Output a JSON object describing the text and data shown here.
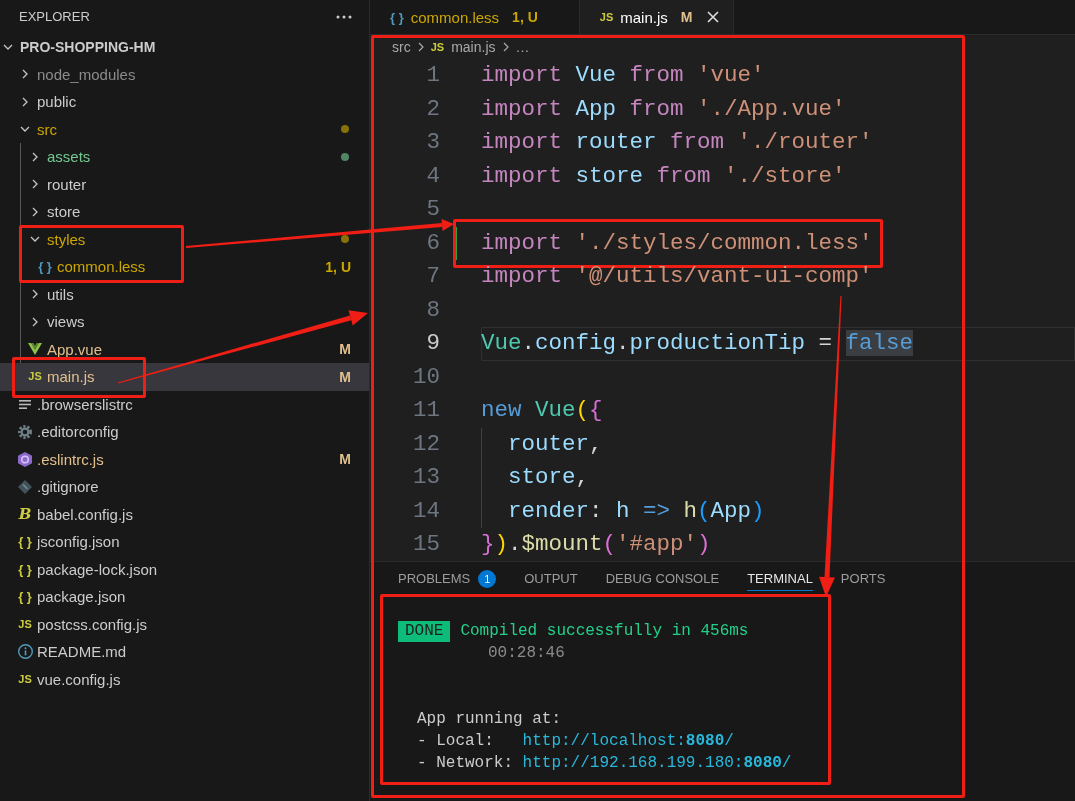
{
  "tabs": [
    {
      "label": "common.less",
      "kind": "less",
      "icon_label": "{ }",
      "color": "#cca700",
      "badge": "1, U",
      "selected": false
    },
    {
      "label": "main.js",
      "kind": "js",
      "icon_label": "JS",
      "color": "#e2c08d",
      "badge": "M",
      "selected": true
    }
  ],
  "explorer": {
    "title": "EXPLORER",
    "project": {
      "name": "PRO-SHOPPING-HM",
      "expanded": true,
      "children": [
        {
          "name": "node_modules",
          "kind": "folder",
          "expanded": false,
          "selected": false,
          "annotated": false,
          "color": "#8c8c8c",
          "dot": false
        },
        {
          "name": "public",
          "kind": "folder",
          "expanded": false,
          "selected": false,
          "annotated": false,
          "dot": false
        },
        {
          "name": "src",
          "kind": "folder",
          "expanded": true,
          "selected": false,
          "annotated": false,
          "color": "#cca700",
          "dot": true,
          "children": [
            {
              "name": "assets",
              "kind": "folder",
              "expanded": false,
              "selected": false,
              "annotated": false,
              "color": "#73c991",
              "dot": true
            },
            {
              "name": "router",
              "kind": "folder",
              "expanded": false,
              "selected": false,
              "annotated": false,
              "dot": false
            },
            {
              "name": "store",
              "kind": "folder",
              "expanded": false,
              "selected": false,
              "annotated": false,
              "dot": false
            },
            {
              "name": "styles",
              "kind": "folder",
              "expanded": true,
              "selected": false,
              "annotated": true,
              "color": "#cca700",
              "dot": true,
              "children": [
                {
                  "name": "common.less",
                  "kind": "less",
                  "icon_label": "{ }",
                  "selected": false,
                  "annotated": false,
                  "color": "#cca700",
                  "badge": "1, U"
                }
              ]
            },
            {
              "name": "utils",
              "kind": "folder",
              "expanded": false,
              "selected": false,
              "annotated": false,
              "dot": false
            },
            {
              "name": "views",
              "kind": "folder",
              "expanded": false,
              "selected": false,
              "annotated": false,
              "dot": false
            },
            {
              "name": "App.vue",
              "kind": "vue",
              "selected": false,
              "annotated": false,
              "color": "#e2c08d",
              "badge": "M"
            },
            {
              "name": "main.js",
              "kind": "js",
              "icon_label": "JS",
              "selected": true,
              "annotated": true,
              "color": "#e2c08d",
              "badge": "M"
            }
          ]
        },
        {
          "name": ".browserslistrc",
          "kind": "text",
          "selected": false,
          "annotated": false
        },
        {
          "name": ".editorconfig",
          "kind": "config",
          "selected": false,
          "annotated": false
        },
        {
          "name": ".eslintrc.js",
          "kind": "eslint",
          "selected": false,
          "annotated": false,
          "color": "#e2c08d",
          "badge": "M"
        },
        {
          "name": ".gitignore",
          "kind": "git",
          "selected": false,
          "annotated": false
        },
        {
          "name": "babel.config.js",
          "kind": "babel",
          "icon_label": "B",
          "selected": false,
          "annotated": false
        },
        {
          "name": "jsconfig.json",
          "kind": "json",
          "icon_label": "{ }",
          "selected": false,
          "annotated": false
        },
        {
          "name": "package-lock.json",
          "kind": "json",
          "icon_label": "{ }",
          "selected": false,
          "annotated": false
        },
        {
          "name": "package.json",
          "kind": "json",
          "icon_label": "{ }",
          "selected": false,
          "annotated": false
        },
        {
          "name": "postcss.config.js",
          "kind": "js",
          "icon_label": "JS",
          "selected": false,
          "annotated": false
        },
        {
          "name": "README.md",
          "kind": "markdown",
          "selected": false,
          "annotated": false
        },
        {
          "name": "vue.config.js",
          "kind": "js",
          "icon_label": "JS",
          "selected": false,
          "annotated": false
        }
      ]
    }
  },
  "editor": {
    "annotated": true,
    "breadcrumb": [
      {
        "label": "src",
        "kind": "folder"
      },
      {
        "label": "main.js",
        "kind": "js",
        "icon_label": "JS"
      },
      {
        "label": "…",
        "kind": "symbol"
      }
    ],
    "lines": [
      {
        "number": "1",
        "current": false,
        "added": false,
        "annotated": false,
        "indented": false,
        "tokens": [
          {
            "kind": "keyword",
            "text": "import "
          },
          {
            "kind": "variable",
            "text": "Vue "
          },
          {
            "kind": "keyword",
            "text": "from "
          },
          {
            "kind": "string",
            "text": "'vue'"
          }
        ]
      },
      {
        "number": "2",
        "current": false,
        "added": false,
        "annotated": false,
        "indented": false,
        "tokens": [
          {
            "kind": "keyword",
            "text": "import "
          },
          {
            "kind": "variable",
            "text": "App "
          },
          {
            "kind": "keyword",
            "text": "from "
          },
          {
            "kind": "string",
            "text": "'./App.vue'"
          }
        ]
      },
      {
        "number": "3",
        "current": false,
        "added": false,
        "annotated": false,
        "indented": false,
        "tokens": [
          {
            "kind": "keyword",
            "text": "import "
          },
          {
            "kind": "variable",
            "text": "router "
          },
          {
            "kind": "keyword",
            "text": "from "
          },
          {
            "kind": "string",
            "text": "'./router'"
          }
        ]
      },
      {
        "number": "4",
        "current": false,
        "added": false,
        "annotated": false,
        "indented": false,
        "tokens": [
          {
            "kind": "keyword",
            "text": "import "
          },
          {
            "kind": "variable",
            "text": "store "
          },
          {
            "kind": "keyword",
            "text": "from "
          },
          {
            "kind": "string",
            "text": "'./store'"
          }
        ]
      },
      {
        "number": "5",
        "current": false,
        "added": false,
        "annotated": false,
        "indented": false
      },
      {
        "number": "6",
        "current": false,
        "added": true,
        "annotated": true,
        "indented": false,
        "tokens": [
          {
            "kind": "keyword",
            "text": "import "
          },
          {
            "kind": "string",
            "text": "'./styles/common.less'"
          }
        ]
      },
      {
        "number": "7",
        "current": false,
        "added": false,
        "annotated": false,
        "indented": false,
        "tokens": [
          {
            "kind": "keyword",
            "text": "import "
          },
          {
            "kind": "string",
            "text": "'@/utils/vant-ui-comp'"
          }
        ]
      },
      {
        "number": "8",
        "current": false,
        "added": false,
        "annotated": false,
        "indented": false
      },
      {
        "number": "9",
        "current": true,
        "added": false,
        "annotated": false,
        "indented": false,
        "tokens": [
          {
            "kind": "class",
            "text": "Vue"
          },
          {
            "kind": "plain",
            "text": "."
          },
          {
            "kind": "variable",
            "text": "config"
          },
          {
            "kind": "plain",
            "text": "."
          },
          {
            "kind": "variable",
            "text": "productionTip"
          },
          {
            "kind": "plain",
            "text": " = "
          },
          {
            "kind": "storage",
            "text": "false",
            "marked": true
          }
        ]
      },
      {
        "number": "10",
        "current": false,
        "added": false,
        "annotated": false,
        "indented": false
      },
      {
        "number": "11",
        "current": false,
        "added": false,
        "annotated": false,
        "indented": false,
        "tokens": [
          {
            "kind": "storage",
            "text": "new "
          },
          {
            "kind": "class",
            "text": "Vue"
          },
          {
            "kind": "bracket1",
            "text": "("
          },
          {
            "kind": "bracket2",
            "text": "{"
          }
        ]
      },
      {
        "number": "12",
        "current": false,
        "added": false,
        "annotated": false,
        "indented": true,
        "tokens": [
          {
            "kind": "variable",
            "text": "router"
          },
          {
            "kind": "plain",
            "text": ","
          }
        ]
      },
      {
        "number": "13",
        "current": false,
        "added": false,
        "annotated": false,
        "indented": true,
        "tokens": [
          {
            "kind": "variable",
            "text": "store"
          },
          {
            "kind": "plain",
            "text": ","
          }
        ]
      },
      {
        "number": "14",
        "current": false,
        "added": false,
        "annotated": false,
        "indented": true,
        "tokens": [
          {
            "kind": "variable",
            "text": "render"
          },
          {
            "kind": "plain",
            "text": ": "
          },
          {
            "kind": "variable",
            "text": "h "
          },
          {
            "kind": "storage",
            "text": "=> "
          },
          {
            "kind": "function",
            "text": "h"
          },
          {
            "kind": "bracket3",
            "text": "("
          },
          {
            "kind": "variable",
            "text": "App"
          },
          {
            "kind": "bracket3",
            "text": ")"
          }
        ]
      },
      {
        "number": "15",
        "current": false,
        "added": false,
        "annotated": false,
        "indented": false,
        "tokens": [
          {
            "kind": "bracket2",
            "text": "}"
          },
          {
            "kind": "bracket1",
            "text": ")"
          },
          {
            "kind": "plain",
            "text": "."
          },
          {
            "kind": "function",
            "text": "$mount"
          },
          {
            "kind": "bracket2",
            "text": "("
          },
          {
            "kind": "string",
            "text": "'#app'"
          },
          {
            "kind": "bracket2",
            "text": ")"
          }
        ]
      }
    ]
  },
  "panel": {
    "tabs": [
      {
        "label": "PROBLEMS",
        "count": "1",
        "selected": false
      },
      {
        "label": "OUTPUT",
        "selected": false
      },
      {
        "label": "DEBUG CONSOLE",
        "selected": false
      },
      {
        "label": "TERMINAL",
        "selected": true
      },
      {
        "label": "PORTS",
        "selected": false
      }
    ],
    "terminal": {
      "annotated": true,
      "status": {
        "badge": "DONE",
        "message": "Compiled successfully in 456ms",
        "time": "00:28:46"
      },
      "lines": [
        {
          "kind": "text",
          "text": "App running at:"
        },
        {
          "kind": "address",
          "label": "- Local:",
          "url": "http://localhost:**8080**/"
        },
        {
          "kind": "address",
          "label": "- Network:",
          "url": "http://192.168.199.180:**8080**/"
        }
      ]
    }
  }
}
